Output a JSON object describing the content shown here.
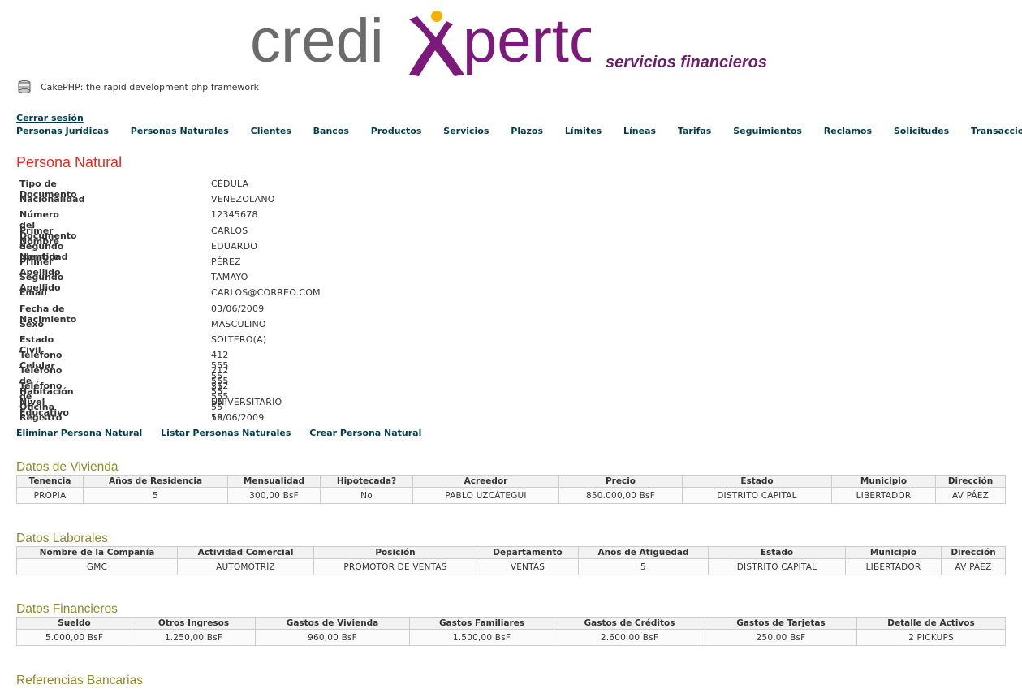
{
  "header": {
    "logo_text_left": "credi",
    "logo_text_right": "perto",
    "tagline": "servicios financieros",
    "cake_label": "CakePHP: the rapid development php framework",
    "logout": "Cerrar sesión",
    "colors": {
      "logo_gray": "#6b6b6b",
      "logo_purple": "#7b1a7b",
      "logo_gold": "#f2b300",
      "title_red": "#e32c21",
      "section_olive": "#8b8b2d",
      "link": "#003d4c"
    }
  },
  "nav": [
    "Personas Jurídicas",
    "Personas Naturales",
    "Clientes",
    "Bancos",
    "Productos",
    "Servicios",
    "Plazos",
    "Límites",
    "Líneas",
    "Tarifas",
    "Seguimientos",
    "Reclamos",
    "Solicitudes",
    "Transacciones"
  ],
  "page_title": "Persona Natural",
  "details": [
    {
      "label": "Tipo de Documento",
      "value": "CÉDULA"
    },
    {
      "label": "Nacionalidad",
      "value": "VENEZOLANO"
    },
    {
      "label": "Número del Documento de Identidad",
      "value": "12345678"
    },
    {
      "label": "Primer Nombre",
      "value": "CARLOS"
    },
    {
      "label": "Segundo Nombre",
      "value": "EDUARDO"
    },
    {
      "label": "Primer Apellido",
      "value": "PÉREZ"
    },
    {
      "label": "Segundo Apellido",
      "value": "TAMAYO"
    },
    {
      "label": "Email",
      "value": "CARLOS@CORREO.COM"
    },
    {
      "label": "Fecha de Nacimiento",
      "value": "03/06/2009"
    },
    {
      "label": "Sexo",
      "value": "MASCULINO"
    },
    {
      "label": "Estado Civil",
      "value": "SOLTERO(A)"
    },
    {
      "label": "Teléfono Celular",
      "value": "412 555 55 55"
    },
    {
      "label": "Teléfono de Habitación",
      "value": "212 555 55 55"
    },
    {
      "label": "Teléfono de Oficina",
      "value": "212 555 55 56"
    },
    {
      "label": "Nivel Educativo",
      "value": "UNIVERSITARIO"
    },
    {
      "label": "Registro",
      "value": "19/06/2009"
    }
  ],
  "actions": [
    "Eliminar Persona Natural",
    "Listar Personas Naturales",
    "Crear Persona Natural"
  ],
  "vivienda": {
    "title": "Datos de Vivienda",
    "headers": [
      "Tenencia",
      "Años de Residencia",
      "Mensualidad",
      "Hipotecada?",
      "Acreedor",
      "Precio",
      "Estado",
      "Municipio",
      "Dirección"
    ],
    "row": [
      "PROPIA",
      "5",
      "300,00 BsF",
      "No",
      "PABLO UZCÁTEGUI",
      "850.000,00 BsF",
      "DISTRITO CAPITAL",
      "LIBERTADOR",
      "AV PÁEZ"
    ]
  },
  "laborales": {
    "title": "Datos Laborales",
    "headers": [
      "Nombre de la Compañía",
      "Actividad Comercial",
      "Posición",
      "Departamento",
      "Años de Atigüedad",
      "Estado",
      "Municipio",
      "Dirección"
    ],
    "row": [
      "GMC",
      "AUTOMOTRÍZ",
      "PROMOTOR DE VENTAS",
      "VENTAS",
      "5",
      "DISTRITO CAPITAL",
      "LIBERTADOR",
      "AV PÁEZ"
    ]
  },
  "financieros": {
    "title": "Datos Financieros",
    "headers": [
      "Sueldo",
      "Otros Ingresos",
      "Gastos de Vivienda",
      "Gastos Familiares",
      "Gastos de Créditos",
      "Gastos de Tarjetas",
      "Detalle de Activos"
    ],
    "row": [
      "5.000,00 BsF",
      "1.250,00 BsF",
      "960,00 BsF",
      "1.500,00 BsF",
      "2.600,00 BsF",
      "250,00 BsF",
      "2 PICKUPS"
    ]
  },
  "bancarias": {
    "title": "Referencias Bancarias"
  }
}
